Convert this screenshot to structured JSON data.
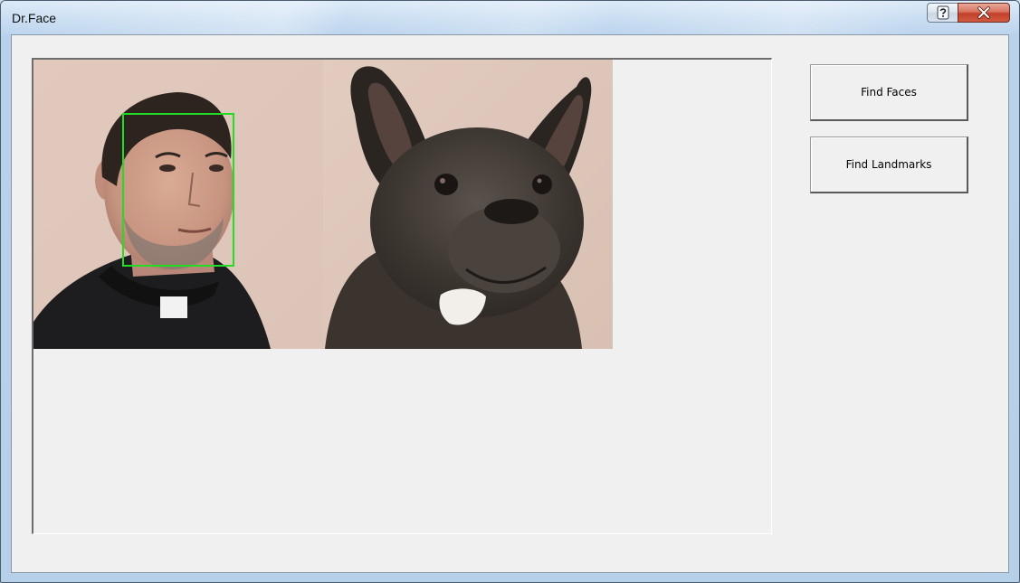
{
  "window": {
    "title": "Dr.Face"
  },
  "caption_buttons": {
    "help_icon": "help-icon",
    "close_icon": "close-icon"
  },
  "toolbar": {
    "find_faces_label": "Find Faces",
    "find_landmarks_label": "Find Landmarks"
  },
  "image": {
    "panels": [
      "man-with-clerical-collar",
      "french-bulldog"
    ],
    "detection_box_color": "#22dd22",
    "detections_count": 1
  },
  "colors": {
    "face_box": "#22dd22",
    "close_button": "#c2402a"
  }
}
